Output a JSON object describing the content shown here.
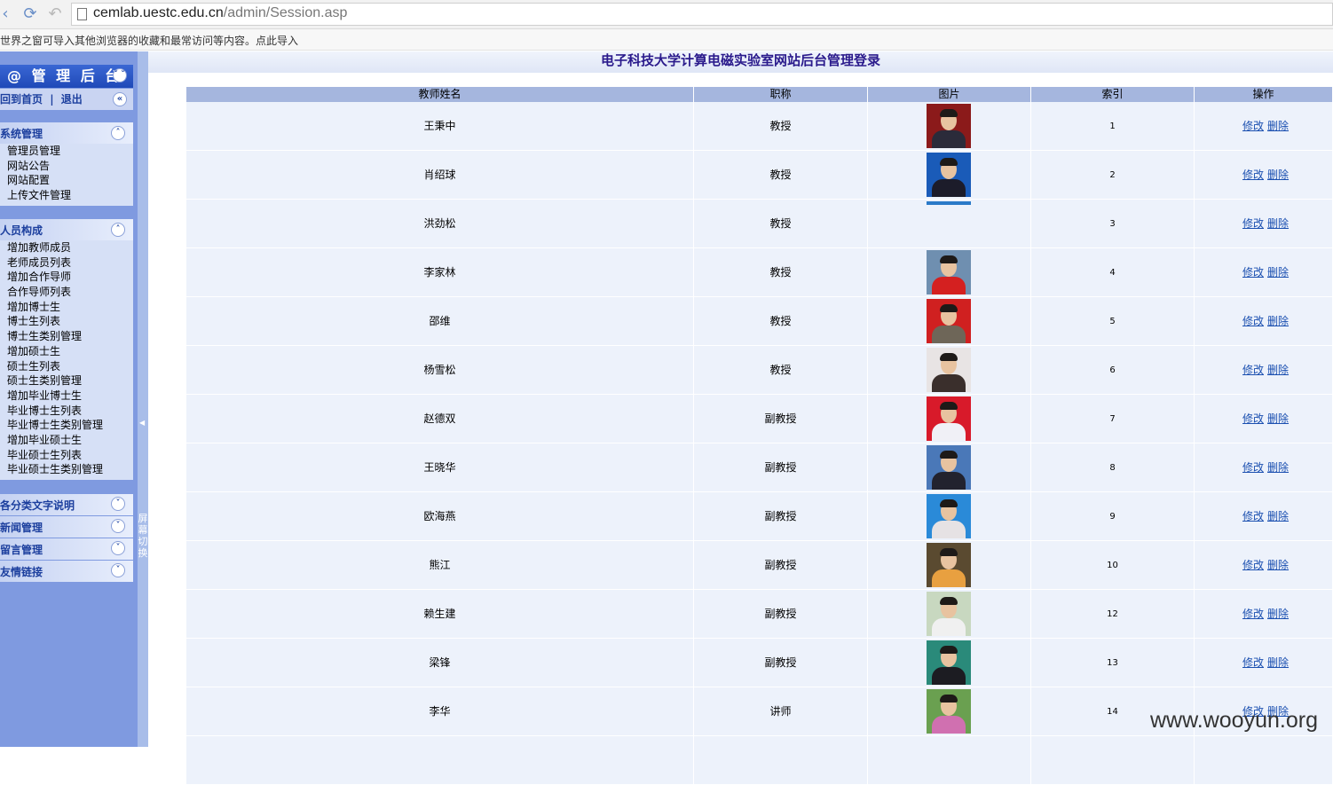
{
  "browser": {
    "url_host": "cemlab.uestc.edu.cn",
    "url_path": "/admin/Session.asp",
    "import_text": "世界之窗可导入其他浏览器的收藏和最常访问等内容。",
    "import_link": "点此导入"
  },
  "sidebar": {
    "title": "@ 管 理 后 台",
    "home_link": "回到首页",
    "separator": "|",
    "logout_link": "退出",
    "groups": [
      {
        "label": "系统管理",
        "items": [
          "管理员管理",
          "网站公告",
          "网站配置",
          "上传文件管理"
        ]
      },
      {
        "label": "人员构成",
        "items": [
          "增加教师成员",
          "老师成员列表",
          "增加合作导师",
          "合作导师列表",
          "增加博士生",
          "博士生列表",
          "博士生类别管理",
          "增加硕士生",
          "硕士生列表",
          "硕士生类别管理",
          "增加毕业博士生",
          "毕业博士生列表",
          "毕业博士生类别管理",
          "增加毕业硕士生",
          "毕业硕士生列表",
          "毕业硕士生类别管理"
        ]
      }
    ],
    "collapsed": [
      "各分类文字说明",
      "新闻管理",
      "留言管理",
      "友情链接"
    ],
    "splitter_text": "屏幕切换"
  },
  "main": {
    "title": "电子科技大学计算电磁实验室网站后台管理登录",
    "columns": [
      "教师姓名",
      "职称",
      "图片",
      "索引",
      "操作"
    ],
    "edit_label": "修改",
    "delete_label": "删除",
    "rows": [
      {
        "name": "王秉中",
        "title": "教授",
        "index": "1",
        "photo": true
      },
      {
        "name": "肖绍球",
        "title": "教授",
        "index": "2",
        "photo": true
      },
      {
        "name": "洪劲松",
        "title": "教授",
        "index": "3",
        "photo": false
      },
      {
        "name": "李家林",
        "title": "教授",
        "index": "4",
        "photo": true
      },
      {
        "name": "邵维",
        "title": "教授",
        "index": "5",
        "photo": true
      },
      {
        "name": "杨雪松",
        "title": "教授",
        "index": "6",
        "photo": true
      },
      {
        "name": "赵德双",
        "title": "副教授",
        "index": "7",
        "photo": true
      },
      {
        "name": "王晓华",
        "title": "副教授",
        "index": "8",
        "photo": true
      },
      {
        "name": "欧海燕",
        "title": "副教授",
        "index": "9",
        "photo": true
      },
      {
        "name": "熊江",
        "title": "副教授",
        "index": "10",
        "photo": true
      },
      {
        "name": "赖生建",
        "title": "副教授",
        "index": "12",
        "photo": true
      },
      {
        "name": "梁锋",
        "title": "副教授",
        "index": "13",
        "photo": true
      },
      {
        "name": "李华",
        "title": "讲师",
        "index": "14",
        "photo": true
      }
    ]
  },
  "watermark": "www.wooyun.org",
  "colors": {
    "sidebar_bg": "#7f9ae0",
    "header_bg": "#a5b6de",
    "row_bg": "#edf2fb",
    "title_color": "#2a1a8c",
    "link_color": "#1a4fb0"
  }
}
